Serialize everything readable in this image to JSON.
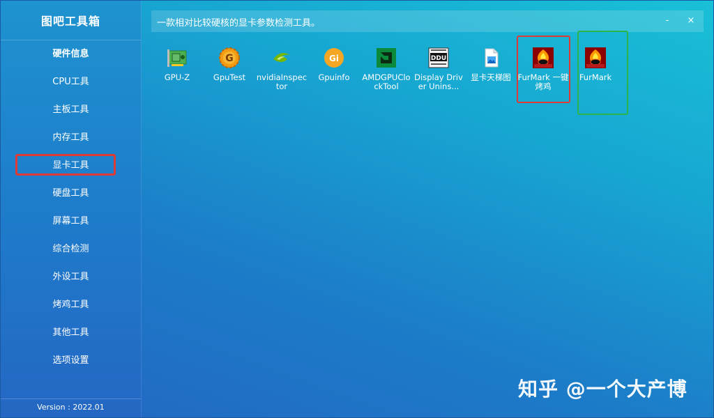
{
  "app": {
    "title": "图吧工具箱",
    "version": "Version : 2022.01"
  },
  "sidebar": {
    "items": [
      {
        "label": "硬件信息"
      },
      {
        "label": "CPU工具"
      },
      {
        "label": "主板工具"
      },
      {
        "label": "内存工具"
      },
      {
        "label": "显卡工具"
      },
      {
        "label": "硬盘工具"
      },
      {
        "label": "屏幕工具"
      },
      {
        "label": "综合检测"
      },
      {
        "label": "外设工具"
      },
      {
        "label": "烤鸡工具"
      },
      {
        "label": "其他工具"
      },
      {
        "label": "选项设置"
      }
    ],
    "active_index": 4
  },
  "topbar": {
    "description": "一款相对比较硬核的显卡参数检测工具。",
    "minimize": "-",
    "close": "×"
  },
  "tools": [
    {
      "label": "GPU-Z",
      "icon": "gpu-card-icon"
    },
    {
      "label": "GpuTest",
      "icon": "gpu-test-gear-icon"
    },
    {
      "label": "nvidiaInspector",
      "icon": "nvidia-icon"
    },
    {
      "label": "Gpuinfo",
      "icon": "gpuinfo-icon"
    },
    {
      "label": "AMDGPUClockTool",
      "icon": "amd-icon"
    },
    {
      "label": "Display Driver Unins...",
      "icon": "ddu-icon"
    },
    {
      "label": "显卡天梯图",
      "icon": "image-file-icon"
    },
    {
      "label": "FurMark 一键烤鸡",
      "icon": "furmark-icon"
    },
    {
      "label": "FurMark",
      "icon": "furmark-icon"
    }
  ],
  "watermark": "知乎 @一个大产博",
  "colors": {
    "highlight_red": "#e03a35",
    "highlight_green": "#2bb44a"
  }
}
